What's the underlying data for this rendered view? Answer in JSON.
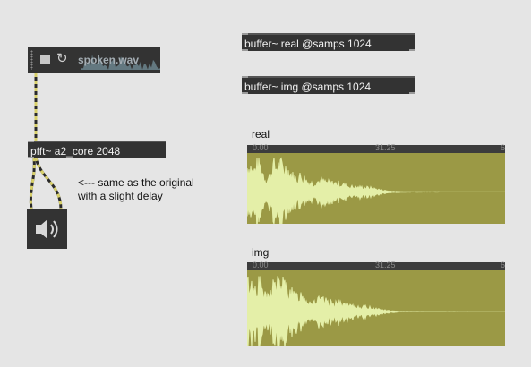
{
  "objects": {
    "buffer_real": "buffer~ real @samps 1024",
    "buffer_img": "buffer~ img @samps 1024",
    "pfft": "pfft~ a2_core 2048"
  },
  "player": {
    "filename": "spoken.wav"
  },
  "comment": "<--- same as the original\nwith a slight delay",
  "displays": {
    "real": {
      "label": "real",
      "ruler_left": "0.00",
      "ruler_mid": "31.25",
      "ruler_right": "6"
    },
    "img": {
      "label": "img",
      "ruler_left": "0.00",
      "ruler_mid": "31.25",
      "ruler_right": "6"
    }
  },
  "colors": {
    "background": "#e5e5e5",
    "object": "#333333",
    "waveform_bg": "#9b9945",
    "waveform_fg": "#e4efa8",
    "patch_cord": "#d8d06a"
  },
  "icons": {
    "stop": "stop-icon",
    "loop": "loop-icon",
    "speaker": "speaker-icon"
  }
}
